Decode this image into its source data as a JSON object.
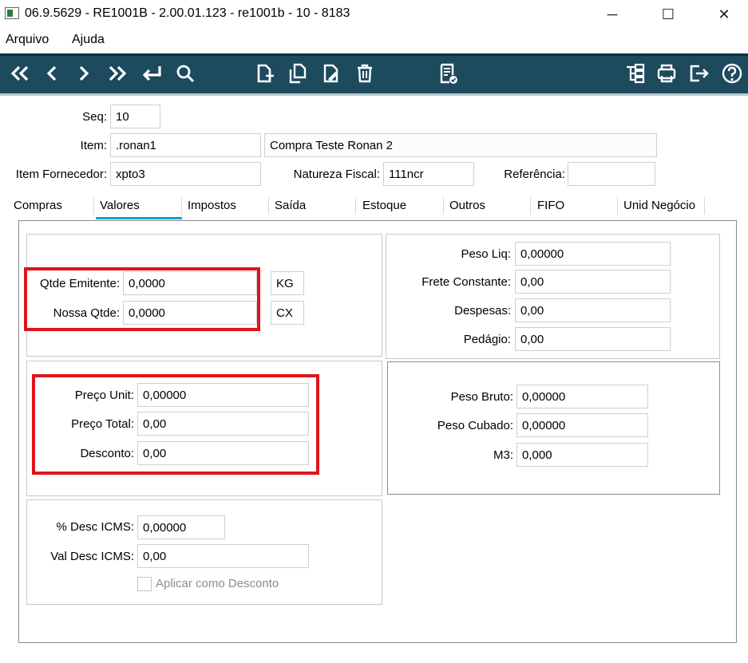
{
  "window": {
    "title": "06.9.5629 - RE1001B - 2.00.01.123 - re1001b - 10 - 8183",
    "minimize": "─",
    "maximize": "☐",
    "close": "✕"
  },
  "menu": {
    "items": [
      "Arquivo",
      "Ajuda"
    ]
  },
  "toolbar": {
    "nav_icons": [
      "first-icon",
      "previous-icon",
      "next-icon",
      "last-icon",
      "goto-icon",
      "search-icon"
    ],
    "edit_icons": [
      "new-icon",
      "copy-icon",
      "edit-icon",
      "delete-icon"
    ],
    "middle_icons": [
      "list-check-icon"
    ],
    "right_icons": [
      "tree-icon",
      "print-icon",
      "exit-icon",
      "help-icon"
    ],
    "bg_color": "#1d4a5c"
  },
  "header": {
    "seq_label": "Seq:",
    "seq_value": "10",
    "item_label": "Item:",
    "item_value": ".ronan1",
    "item_description": "Compra Teste Ronan 2",
    "item_fornecedor_label": "Item Fornecedor:",
    "item_fornecedor_value": "xpto3",
    "natureza_label": "Natureza Fiscal:",
    "natureza_value": "111ncr",
    "referencia_label": "Referência:",
    "referencia_value": ""
  },
  "tabs": [
    "Compras",
    "Valores",
    "Impostos",
    "Saída",
    "Estoque",
    "Outros",
    "FIFO",
    "Unid Negócio"
  ],
  "active_tab": "Valores",
  "valores": {
    "qtde_emitente_label": "Qtde Emitente:",
    "qtde_emitente_value": "0,0000",
    "qtde_emitente_unit": "KG",
    "nossa_qtde_label": "Nossa Qtde:",
    "nossa_qtde_value": "0,0000",
    "nossa_qtde_unit": "CX",
    "preco_unit_label": "Preço Unit:",
    "preco_unit_value": "0,00000",
    "preco_total_label": "Preço Total:",
    "preco_total_value": "0,00",
    "desconto_label": "Desconto:",
    "desconto_value": "0,00",
    "desc_icms_label": "% Desc ICMS:",
    "desc_icms_value": "0,00000",
    "val_desc_icms_label": "Val Desc ICMS:",
    "val_desc_icms_value": "0,00",
    "aplicar_desconto_label": "Aplicar como Desconto",
    "peso_liq_label": "Peso Liq:",
    "peso_liq_value": "0,00000",
    "frete_label": "Frete Constante:",
    "frete_value": "0,00",
    "despesas_label": "Despesas:",
    "despesas_value": "0,00",
    "pedagio_label": "Pedágio:",
    "pedagio_value": "0,00",
    "peso_bruto_label": "Peso Bruto:",
    "peso_bruto_value": "0,00000",
    "peso_cubado_label": "Peso Cubado:",
    "peso_cubado_value": "0,00000",
    "m3_label": "M3:",
    "m3_value": "0,000"
  },
  "colors": {
    "highlight": "#e0141b",
    "tab_accent": "#1a9bd8"
  }
}
